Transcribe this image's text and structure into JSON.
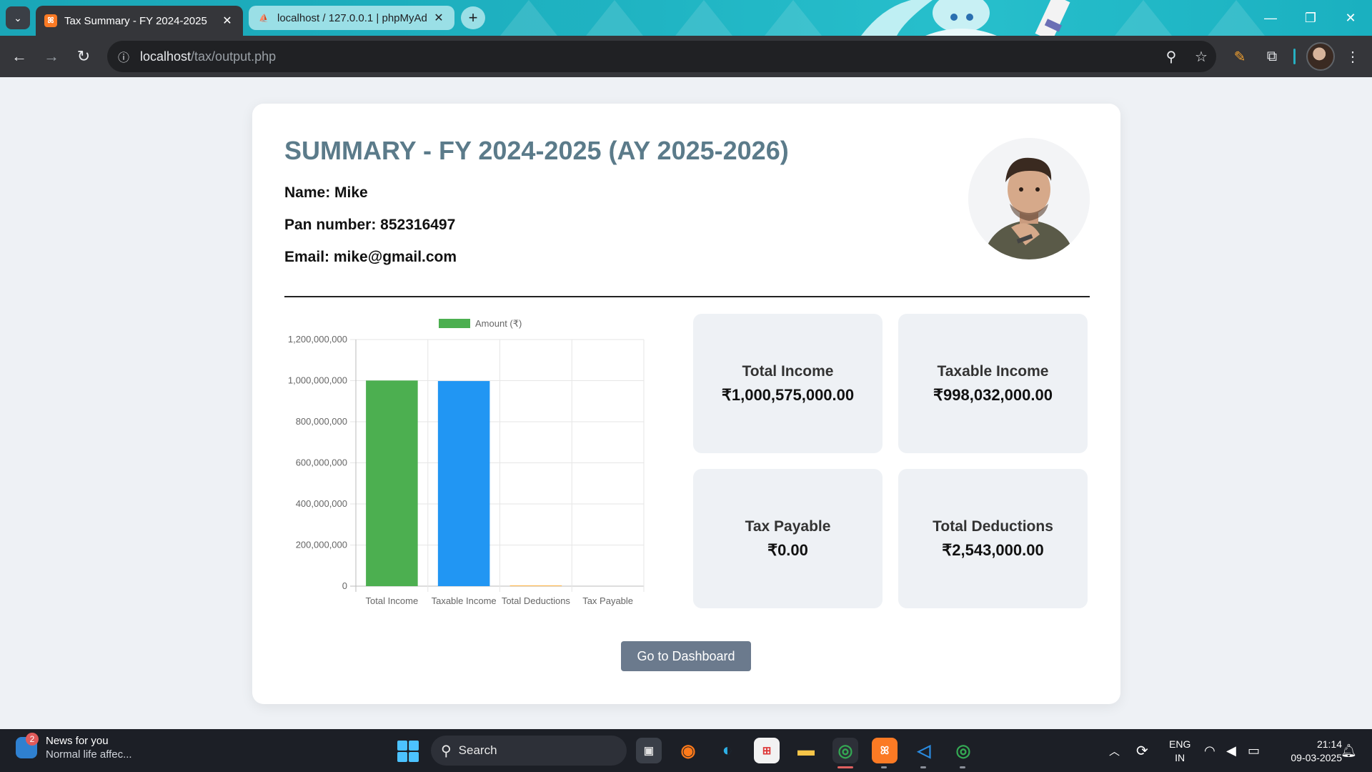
{
  "browser": {
    "tabs": [
      {
        "title": "Tax Summary - FY 2024-2025",
        "favicon": "xampp-icon",
        "active": true
      },
      {
        "title": "localhost / 127.0.0.1 | phpMyAd",
        "favicon": "phpmyadmin-icon",
        "active": false
      }
    ],
    "url_host": "localhost",
    "url_path": "/tax/output.php"
  },
  "summary": {
    "title": "SUMMARY - FY 2024-2025 (AY 2025-2026)",
    "name_line": "Name: Mike",
    "pan_line": "Pan number: 852316497",
    "email_line": "Email: mike@gmail.com"
  },
  "stats": [
    {
      "label": "Total Income",
      "value": "₹1,000,575,000.00"
    },
    {
      "label": "Taxable Income",
      "value": "₹998,032,000.00"
    },
    {
      "label": "Tax Payable",
      "value": "₹0.00"
    },
    {
      "label": "Total Deductions",
      "value": "₹2,543,000.00"
    }
  ],
  "chart_data": {
    "type": "bar",
    "categories": [
      "Total Income",
      "Taxable Income",
      "Total Deductions",
      "Tax Payable"
    ],
    "series": [
      {
        "name": "Amount (₹)",
        "values": [
          1000575000,
          998032000,
          2543000,
          0
        ]
      }
    ],
    "bar_colors": [
      "#4caf50",
      "#2196f3",
      "#ff9800",
      "#f44336"
    ],
    "legend_color": "#4caf50",
    "y_ticks": [
      "1,200,000,000",
      "1,000,000,000",
      "800,000,000",
      "600,000,000",
      "400,000,000",
      "200,000,000",
      "0"
    ],
    "ylim": [
      0,
      1200000000
    ],
    "grid": true,
    "legend_position": "top"
  },
  "actions": {
    "dashboard_label": "Go to Dashboard"
  },
  "taskbar": {
    "news_title": "News for you",
    "news_sub": "Normal life affec...",
    "news_badge": "2",
    "search_label": "Search",
    "lang_1": "ENG",
    "lang_2": "IN",
    "time": "21:14",
    "date": "09-03-2025"
  }
}
